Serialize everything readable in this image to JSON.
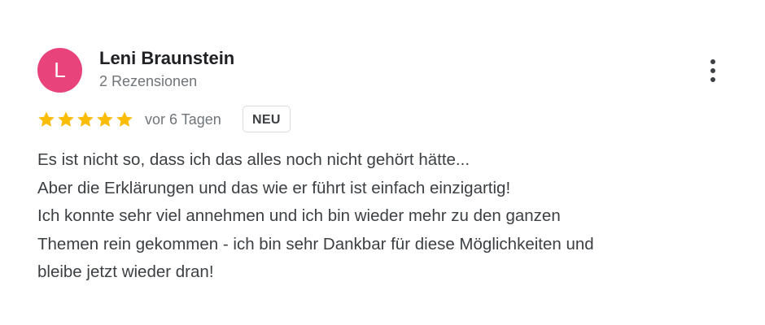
{
  "review": {
    "avatar_letter": "L",
    "avatar_color": "#e8437a",
    "author_name": "Leni Braunstein",
    "review_count": "2 Rezensionen",
    "rating": 5,
    "rating_max": 5,
    "star_color": "#fbbc04",
    "date": "vor 6 Tagen",
    "badge": "NEU",
    "more_icon": "more-vertical-icon",
    "text_lines": [
      "Es ist nicht so, dass ich das alles noch nicht gehört hätte...",
      "Aber die Erklärungen und das wie er führt ist einfach einzigartig!",
      "Ich konnte sehr viel annehmen und ich bin wieder mehr zu den ganzen",
      "Themen rein gekommen - ich bin sehr Dankbar für diese Möglichkeiten und",
      "bleibe jetzt wieder dran!"
    ]
  }
}
